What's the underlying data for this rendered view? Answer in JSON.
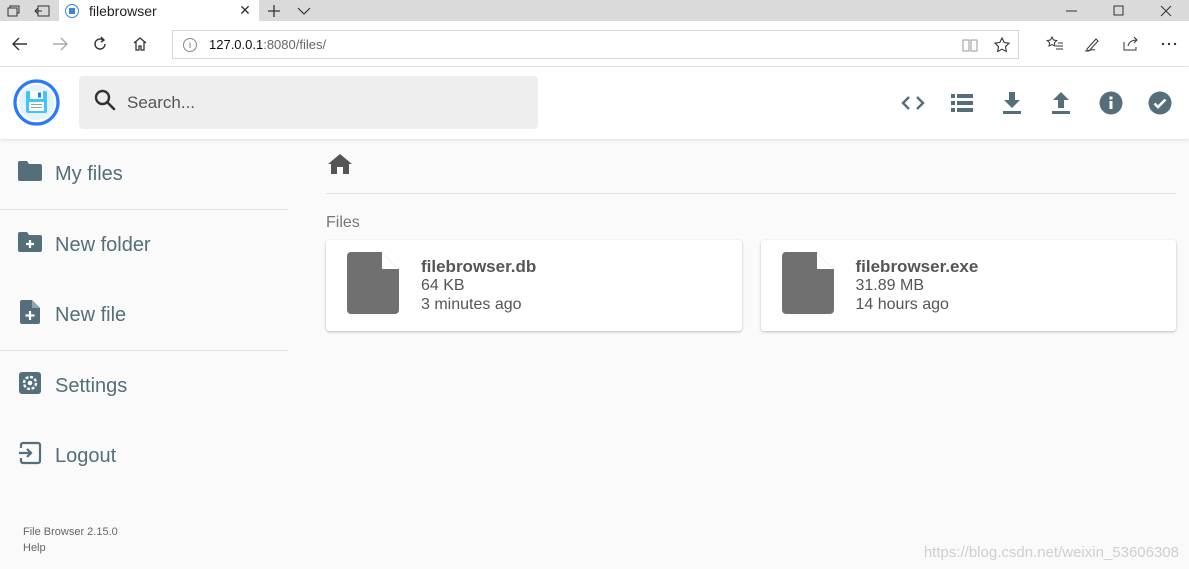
{
  "browser": {
    "tab_title": "filebrowser",
    "url_host": "127.0.0.1",
    "url_path": ":8080/files/"
  },
  "header": {
    "search_placeholder": "Search...",
    "accent": "#2979ff"
  },
  "sidebar": {
    "items": [
      {
        "label": "My files",
        "icon": "folder-icon"
      },
      {
        "label": "New folder",
        "icon": "create-folder-icon"
      },
      {
        "label": "New file",
        "icon": "note-add-icon"
      },
      {
        "label": "Settings",
        "icon": "gear-icon"
      },
      {
        "label": "Logout",
        "icon": "logout-icon"
      }
    ],
    "version": "File Browser 2.15.0",
    "help": "Help"
  },
  "main": {
    "section_title": "Files",
    "files": [
      {
        "name": "filebrowser.db",
        "size": "64 KB",
        "modified": "3 minutes ago"
      },
      {
        "name": "filebrowser.exe",
        "size": "31.89 MB",
        "modified": "14 hours ago"
      }
    ]
  },
  "watermark": "https://blog.csdn.net/weixin_53606308"
}
